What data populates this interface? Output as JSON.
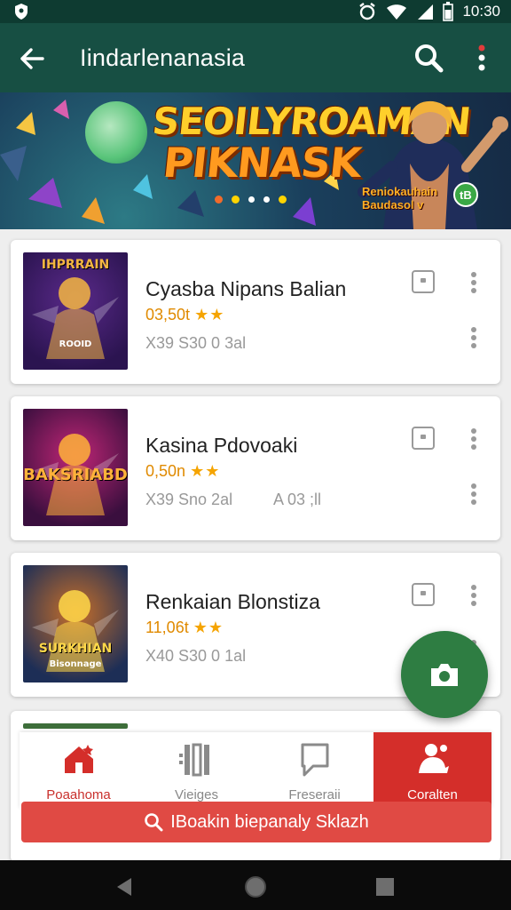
{
  "status_bar": {
    "time": "10:30"
  },
  "app_bar": {
    "title": "Iindarlenanasia",
    "back_icon": "arrow-left-icon",
    "search_icon": "search-icon",
    "more_icon": "more-vert-icon"
  },
  "banner": {
    "title_line1": "SEOILYROAMAN",
    "title_line2": "PIKNASK",
    "hero_caption": "Reniokauhain",
    "hero_caption2": "Baudasol v",
    "indicator_label": "oo"
  },
  "apps": [
    {
      "name": "Cyasba Nipans Balian",
      "rating": "03,50t",
      "stars": "★★",
      "meta": "X39 S30 0 3al",
      "meta2": "",
      "thumb_title": "IHPRRAIN",
      "thumb_sub": "ROOID",
      "thumb_colors": [
        "#5a2a8a",
        "#2b1450",
        "#f4b642"
      ]
    },
    {
      "name": "Kasina Pdovoaki",
      "rating": "0,50n",
      "stars": "★★",
      "meta": "X39 Sno 2al",
      "meta2": "A 03 ;ll",
      "thumb_title": "BAKSRIABD",
      "thumb_sub": "",
      "thumb_colors": [
        "#c02676",
        "#3a0f3e",
        "#ffb23a"
      ]
    },
    {
      "name": "Renkaian Blonstiza",
      "rating": "11,06t",
      "stars": "★★",
      "meta": "X40 S30 0 1al",
      "meta2": "",
      "thumb_title": "SURKHIAN",
      "thumb_sub": "Bisonnage",
      "thumb_colors": [
        "#c76f2a",
        "#1d2e56",
        "#ffd84a"
      ]
    }
  ],
  "bottom_nav": [
    {
      "label": "Poaahoma",
      "icon": "home-icon"
    },
    {
      "label": "Vieiges",
      "icon": "library-icon"
    },
    {
      "label": "Freseraii",
      "icon": "chat-bubble-icon"
    },
    {
      "label": "Coralten",
      "icon": "profile-icon"
    }
  ],
  "search_bar": {
    "label": "IBoakin biepanaly Sklazh"
  },
  "fab": {
    "icon": "camera-icon"
  },
  "colors": {
    "app_bar": "#174f43",
    "status_bar": "#0e3b31",
    "fab": "#2e7d42",
    "active_nav": "#d42e2a",
    "search_bar": "#e04a44",
    "rating": "#e08a00"
  }
}
